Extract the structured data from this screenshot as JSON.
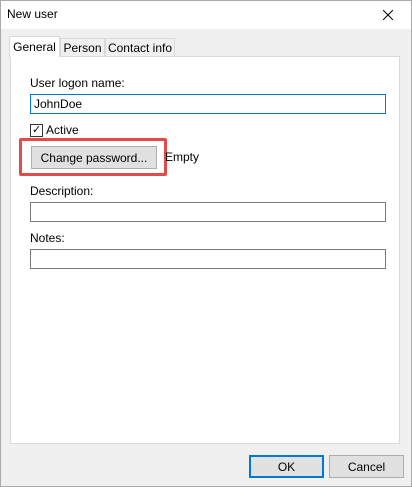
{
  "window": {
    "title": "New user"
  },
  "tabs": [
    {
      "label": "General",
      "active": true
    },
    {
      "label": "Person",
      "active": false
    },
    {
      "label": "Contact info",
      "active": false
    }
  ],
  "general": {
    "logon_label": "User logon name:",
    "logon_value": "JohnDoe",
    "active_label": "Active",
    "active_checked": true,
    "change_password_label": "Change password...",
    "password_status": "Empty",
    "description_label": "Description:",
    "description_value": "",
    "notes_label": "Notes:",
    "notes_value": ""
  },
  "footer": {
    "ok_label": "OK",
    "cancel_label": "Cancel"
  },
  "colors": {
    "highlight": "#e34a4a",
    "focus_border": "#0078d7"
  },
  "icons": {
    "close": "close-icon",
    "check": "check-icon"
  }
}
